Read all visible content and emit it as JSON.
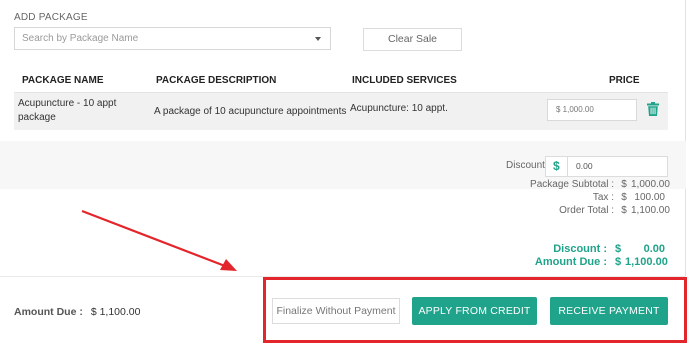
{
  "add_package": {
    "title": "ADD PACKAGE",
    "search_placeholder": "Search by Package Name",
    "clear_label": "Clear Sale"
  },
  "table": {
    "headers": [
      "PACKAGE NAME",
      "PACKAGE DESCRIPTION",
      "INCLUDED SERVICES",
      "PRICE"
    ],
    "rows": [
      {
        "name_line1": "Acupuncture - 10 appt",
        "name_line2": "package",
        "description": "A package of 10 acupuncture appointments",
        "services": "Acupuncture: 10 appt.",
        "price": "$ 1,000.00"
      }
    ]
  },
  "summary": {
    "discount_label": "Discount",
    "discount_currency": "$",
    "discount_value": "0.00",
    "package_subtotal_label": "Package Subtotal :",
    "package_subtotal_currency": "$",
    "package_subtotal": "1,000.00",
    "tax_label": "Tax :",
    "tax_currency": "$",
    "tax": "100.00",
    "order_total_label": "Order Total :",
    "order_total_currency": "$",
    "order_total": "1,100.00",
    "discount_total_label": "Discount :",
    "discount_total_currency": "$",
    "discount_total": "0.00",
    "amount_due_label": "Amount Due :",
    "amount_due_currency": "$",
    "amount_due": "1,100.00"
  },
  "footer": {
    "amount_due_label": "Amount Due :",
    "amount_due": "$ 1,100.00",
    "finalize_label": "Finalize Without Payment",
    "apply_credit_label": "APPLY FROM CREDIT",
    "receive_payment_label": "RECEIVE PAYMENT"
  },
  "icons": {
    "dropdown": "chevron-down-icon",
    "delete": "trash-icon",
    "annotation": "red-arrow-icon"
  },
  "colors": {
    "accent": "#1fa38a",
    "annotation": "#e3262b"
  }
}
